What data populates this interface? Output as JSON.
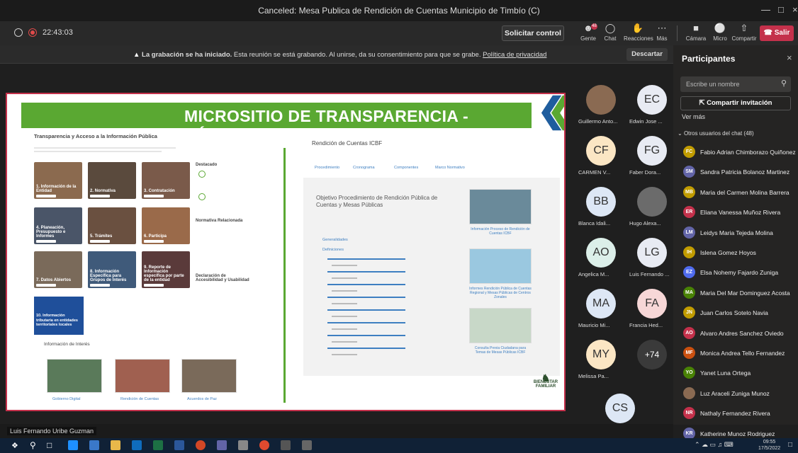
{
  "window": {
    "title": "Canceled: Mesa Publica de Rendición de Cuentas Municipio de Timbío (C)"
  },
  "toolbar": {
    "time": "22:43:03",
    "request_control": "Solicitar control",
    "items": [
      {
        "label": "Gente",
        "icon": "people-icon",
        "badge": "48"
      },
      {
        "label": "Chat",
        "icon": "chat-icon"
      },
      {
        "label": "Reacciones",
        "icon": "reactions-icon"
      },
      {
        "label": "Más",
        "icon": "more-icon"
      },
      {
        "label": "Cámara",
        "icon": "camera-off-icon"
      },
      {
        "label": "Micro",
        "icon": "mic-off-icon"
      },
      {
        "label": "Compartir",
        "icon": "share-icon"
      }
    ],
    "leave": "Salir"
  },
  "banner": {
    "bold": "La grabación se ha iniciado.",
    "text": " Esta reunión se está grabando. Al unirse, da su consentimiento para que se grabe. ",
    "link": "Política de privacidad",
    "dismiss": "Descartar"
  },
  "shared": {
    "header": "MICROSITIO DE TRANSPARENCIA - PÁGINA WEB",
    "left_title": "Transparencia y Acceso a la Información Pública",
    "tiles": [
      "1. Información de la Entidad",
      "2. Normativa",
      "3. Contratación",
      "4. Planeación, Presupuesto e Informes",
      "5. Trámites",
      "6. Participa",
      "7. Datos Abiertos",
      "8. Información Específica para Grupos de Interés",
      "9. Reporte de Información específica por parte de la entidad"
    ],
    "tile10": "10. Información tributaria en entidades territoriales locales",
    "destacado": "Destacado",
    "normativa": "Normativa Relacionada",
    "declaracion": "Declaración de Accesibilidad y Usabilidad",
    "info_interes": "Información de Interés",
    "info_links": [
      "Gobierno Digital",
      "Rendición de Cuentas",
      "Acuerdos de Paz"
    ],
    "right_title": "Rendición de Cuentas ICBF",
    "tabs": [
      "Procedimiento",
      "Cronograma",
      "Componentes",
      "Marco Normativo"
    ],
    "objetivo": "Objetivo Procedimiento de Rendición Pública de Cuentas y Mesas Públicas",
    "generalidades": "Generalidades",
    "definiciones": "Definiciones",
    "cards": [
      "Información Proceso de Rendición de Cuentas ICBF",
      "Informes Rendición Pública de Cuentas Regional y Mesas Públicas de Centros Zonales",
      "Consulta Previa Ciudadana para Temas de Mesas Públicas ICBF"
    ],
    "logo": "BIENESTAR FAMILIAR"
  },
  "gallery": [
    {
      "initials": "",
      "name": "Guillermo Anto...",
      "photo": true,
      "color": "#8a6a52"
    },
    {
      "initials": "EC",
      "name": "Edwin Jose ...",
      "color": "#e8ebf3"
    },
    {
      "initials": "CF",
      "name": "CARMEN V...",
      "color": "#fbe6c4"
    },
    {
      "initials": "FG",
      "name": "Faber Dora...",
      "color": "#e8ebf3"
    },
    {
      "initials": "BB",
      "name": "Blanca Idali...",
      "color": "#dde7f5"
    },
    {
      "initials": "",
      "name": "Hugo Alexa...",
      "photo": true,
      "color": "#6b6b6b"
    },
    {
      "initials": "AO",
      "name": "Angelica M...",
      "color": "#dcefe9"
    },
    {
      "initials": "LG",
      "name": "Luis Fernando ...",
      "color": "#e8ebf3"
    },
    {
      "initials": "MA",
      "name": "Mauricio Mi...",
      "color": "#dde7f5"
    },
    {
      "initials": "FA",
      "name": "Francia Hed...",
      "color": "#f7d7d7"
    },
    {
      "initials": "MY",
      "name": "Melissa Pa...",
      "color": "#fbe6c4"
    },
    {
      "initials": "+74",
      "name": "",
      "color": "#3a3a3a"
    }
  ],
  "self_tile": {
    "initials": "CS"
  },
  "panel": {
    "title": "Participantes",
    "search_placeholder": "Escribe un nombre",
    "invite": "Compartir invitación",
    "see_more": "Ver más",
    "section": "Otros usuarios del chat (48)",
    "people": [
      {
        "initials": "FC",
        "name": "Fabio Adrian Chimborazo Quiñonez",
        "color": "#c19c00"
      },
      {
        "initials": "SM",
        "name": "Sandra Patricia Bolanoz Martinez",
        "color": "#6264a7"
      },
      {
        "initials": "MB",
        "name": "Maria del Carmen Molina Barrera",
        "color": "#c19c00"
      },
      {
        "initials": "ER",
        "name": "Eliana Vanessa Muñoz Rivera",
        "color": "#c4314b"
      },
      {
        "initials": "LM",
        "name": "Leidys Maria Tejeda Molina",
        "color": "#6264a7"
      },
      {
        "initials": "IH",
        "name": "Islena Gomez Hoyos",
        "color": "#c19c00"
      },
      {
        "initials": "EZ",
        "name": "Elsa Nohemy Fajardo Zuniga",
        "color": "#4f6bed"
      },
      {
        "initials": "MA",
        "name": "Maria Del Mar Dominguez Acosta",
        "color": "#498205"
      },
      {
        "initials": "JN",
        "name": "Juan Carlos Sotelo Navia",
        "color": "#c19c00"
      },
      {
        "initials": "AO",
        "name": "Alvaro Andres Sanchez Oviedo",
        "color": "#c4314b"
      },
      {
        "initials": "MF",
        "name": "Monica Andrea Tello Fernandez",
        "color": "#ca5010"
      },
      {
        "initials": "YO",
        "name": "Yanet Luna Ortega",
        "color": "#498205"
      },
      {
        "initials": "",
        "name": "Luz Araceli Zuniga Munoz",
        "color": "#8a6a52"
      },
      {
        "initials": "NR",
        "name": "Nathaly Fernandez Rivera",
        "color": "#c4314b"
      },
      {
        "initials": "KR",
        "name": "Katherine Munoz Rodriguez",
        "color": "#6264a7"
      }
    ]
  },
  "presenter": "Luis Fernando Uribe Guzman",
  "taskbar": {
    "time": "09:55",
    "date": "17/5/2022"
  }
}
